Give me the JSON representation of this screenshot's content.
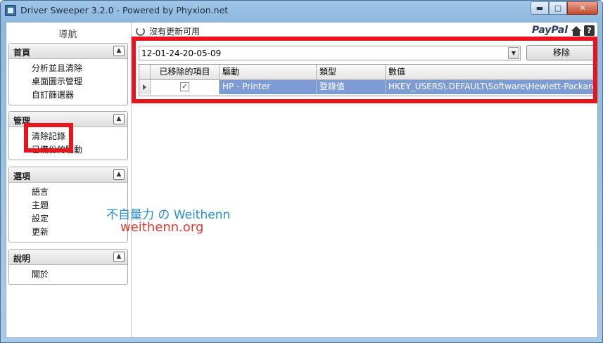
{
  "window": {
    "title": "Driver Sweeper 3.2.0 - Powered by Phyxion.net",
    "controls": {
      "minimize": "▬",
      "maximize": "□",
      "close": "✕"
    }
  },
  "nav": {
    "title": "導航",
    "groups": [
      {
        "label": "首頁",
        "items": [
          "分析並且清除",
          "桌面圖示管理",
          "自訂篩選器"
        ]
      },
      {
        "label": "管理",
        "items": [
          "清除記錄",
          "已備份的驅動"
        ]
      },
      {
        "label": "選項",
        "items": [
          "語言",
          "主題",
          "設定",
          "更新"
        ]
      },
      {
        "label": "說明",
        "items": [
          "關於"
        ]
      }
    ],
    "collapse_glyph": "▲"
  },
  "main": {
    "status_text": "沒有更新可用",
    "paypal_text": "PayPal",
    "help_text": "?",
    "combo_value": "12-01-24-20-05-09",
    "combo_arrow": "▼",
    "remove_button": "移除",
    "grid": {
      "columns": [
        "已移除的項目",
        "驅動",
        "類型",
        "數值"
      ],
      "rows": [
        {
          "removed": "✓",
          "driver": "HP - Printer",
          "type": "登錄值",
          "value": "HKEY_USERS\\.DEFAULT\\Software\\Hewlett-Packard\\"
        }
      ]
    }
  },
  "watermark": {
    "line1": "不自量力 の Weithenn",
    "line2": "weithenn.org"
  },
  "colors": {
    "highlight": "#e8141f",
    "selected_row": "#7d9cd6"
  }
}
